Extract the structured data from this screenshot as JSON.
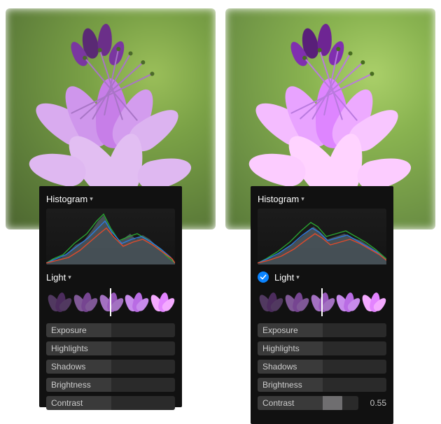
{
  "histogram_label": "Histogram",
  "light_label": "Light",
  "sliders": {
    "exposure": {
      "label": "Exposure",
      "fill_pct": 0
    },
    "highlights": {
      "label": "Highlights",
      "fill_pct": 0
    },
    "shadows": {
      "label": "Shadows",
      "fill_pct": 0
    },
    "brightness": {
      "label": "Brightness",
      "fill_pct": 0
    },
    "contrast": {
      "label": "Contrast",
      "fill_pct": 0
    }
  },
  "right": {
    "contrast": {
      "label": "Contrast",
      "fill_pct": 55,
      "value": "0.55"
    }
  },
  "left_has_check": false,
  "right_has_check": true,
  "thumb_sep_pct": 50
}
